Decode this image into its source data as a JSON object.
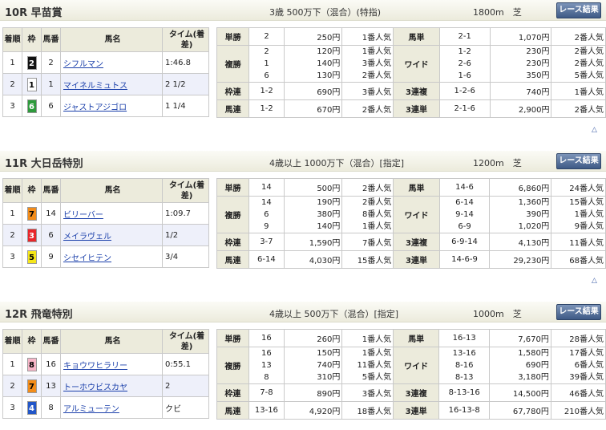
{
  "button_label": "レース結果",
  "top_link": "△",
  "headers": {
    "rank": "着順",
    "waku": "枠",
    "num": "馬番",
    "name": "馬名",
    "time": "タイム(着差)"
  },
  "pay_labels": {
    "tansho": "単勝",
    "fukusho": "複勝",
    "wakuren": "枠連",
    "umaren": "馬連",
    "umatan": "馬単",
    "wide": "ワイド",
    "sanrenpuku": "3連複",
    "sanrentan": "3連単"
  },
  "waku_colors": {
    "1": {
      "bg": "#ffffff",
      "fg": "#000000"
    },
    "2": {
      "bg": "#111111",
      "fg": "#ffffff"
    },
    "3": {
      "bg": "#e8262a",
      "fg": "#ffffff"
    },
    "4": {
      "bg": "#2256c8",
      "fg": "#ffffff"
    },
    "5": {
      "bg": "#f5e61a",
      "fg": "#000000"
    },
    "6": {
      "bg": "#2e9a3c",
      "fg": "#ffffff"
    },
    "7": {
      "bg": "#f28c1a",
      "fg": "#000000"
    },
    "8": {
      "bg": "#f7b6c8",
      "fg": "#000000"
    }
  },
  "races": [
    {
      "title": "10R 早苗賞",
      "conditions": "3歳 500万下（混合）(特指)",
      "distance": "1800m　芝",
      "results": [
        {
          "rank": "1",
          "waku": "2",
          "num": "2",
          "name": "シフルマン",
          "time": "1:46.8"
        },
        {
          "rank": "2",
          "waku": "1",
          "num": "1",
          "name": "マイネルミュトス",
          "time": "2 1/2"
        },
        {
          "rank": "3",
          "waku": "6",
          "num": "6",
          "name": "ジャストアジゴロ",
          "time": "1 1/4"
        }
      ],
      "tansho": {
        "combo": "2",
        "amount": "250円",
        "pop": "1番人気"
      },
      "fukusho": [
        {
          "combo": "2",
          "amount": "120円",
          "pop": "1番人気"
        },
        {
          "combo": "1",
          "amount": "140円",
          "pop": "3番人気"
        },
        {
          "combo": "6",
          "amount": "130円",
          "pop": "2番人気"
        }
      ],
      "wakuren": {
        "combo": "1-2",
        "amount": "690円",
        "pop": "3番人気"
      },
      "umaren": {
        "combo": "1-2",
        "amount": "670円",
        "pop": "2番人気"
      },
      "umatan": {
        "combo": "2-1",
        "amount": "1,070円",
        "pop": "2番人気"
      },
      "wide": [
        {
          "combo": "1-2",
          "amount": "230円",
          "pop": "2番人気"
        },
        {
          "combo": "2-6",
          "amount": "230円",
          "pop": "2番人気"
        },
        {
          "combo": "1-6",
          "amount": "350円",
          "pop": "5番人気"
        }
      ],
      "sanrenpuku": {
        "combo": "1-2-6",
        "amount": "740円",
        "pop": "1番人気"
      },
      "sanrentan": {
        "combo": "2-1-6",
        "amount": "2,900円",
        "pop": "2番人気"
      }
    },
    {
      "title": "11R 大日岳特別",
      "conditions": "4歳以上 1000万下（混合）[指定]",
      "distance": "1200m　芝",
      "results": [
        {
          "rank": "1",
          "waku": "7",
          "num": "14",
          "name": "ビリーバー",
          "time": "1:09.7"
        },
        {
          "rank": "2",
          "waku": "3",
          "num": "6",
          "name": "メイラヴェル",
          "time": "1/2"
        },
        {
          "rank": "3",
          "waku": "5",
          "num": "9",
          "name": "シセイヒテン",
          "time": "3/4"
        }
      ],
      "tansho": {
        "combo": "14",
        "amount": "500円",
        "pop": "2番人気"
      },
      "fukusho": [
        {
          "combo": "14",
          "amount": "190円",
          "pop": "2番人気"
        },
        {
          "combo": "6",
          "amount": "380円",
          "pop": "8番人気"
        },
        {
          "combo": "9",
          "amount": "140円",
          "pop": "1番人気"
        }
      ],
      "wakuren": {
        "combo": "3-7",
        "amount": "1,590円",
        "pop": "7番人気"
      },
      "umaren": {
        "combo": "6-14",
        "amount": "4,030円",
        "pop": "15番人気"
      },
      "umatan": {
        "combo": "14-6",
        "amount": "6,860円",
        "pop": "24番人気"
      },
      "wide": [
        {
          "combo": "6-14",
          "amount": "1,360円",
          "pop": "15番人気"
        },
        {
          "combo": "9-14",
          "amount": "390円",
          "pop": "1番人気"
        },
        {
          "combo": "6-9",
          "amount": "1,020円",
          "pop": "9番人気"
        }
      ],
      "sanrenpuku": {
        "combo": "6-9-14",
        "amount": "4,130円",
        "pop": "11番人気"
      },
      "sanrentan": {
        "combo": "14-6-9",
        "amount": "29,230円",
        "pop": "68番人気"
      }
    },
    {
      "title": "12R 飛竜特別",
      "conditions": "4歳以上 500万下（混合）[指定]",
      "distance": "1000m　芝",
      "results": [
        {
          "rank": "1",
          "waku": "8",
          "num": "16",
          "name": "キョウワヒラリー",
          "time": "0:55.1"
        },
        {
          "rank": "2",
          "waku": "7",
          "num": "13",
          "name": "トーホウビスカヤ",
          "time": "2"
        },
        {
          "rank": "3",
          "waku": "4",
          "num": "8",
          "name": "アルミューテン",
          "time": "クビ"
        }
      ],
      "tansho": {
        "combo": "16",
        "amount": "260円",
        "pop": "1番人気"
      },
      "fukusho": [
        {
          "combo": "16",
          "amount": "150円",
          "pop": "1番人気"
        },
        {
          "combo": "13",
          "amount": "740円",
          "pop": "11番人気"
        },
        {
          "combo": "8",
          "amount": "310円",
          "pop": "5番人気"
        }
      ],
      "wakuren": {
        "combo": "7-8",
        "amount": "890円",
        "pop": "3番人気"
      },
      "umaren": {
        "combo": "13-16",
        "amount": "4,920円",
        "pop": "18番人気"
      },
      "umatan": {
        "combo": "16-13",
        "amount": "7,670円",
        "pop": "28番人気"
      },
      "wide": [
        {
          "combo": "13-16",
          "amount": "1,580円",
          "pop": "17番人気"
        },
        {
          "combo": "8-16",
          "amount": "690円",
          "pop": "6番人気"
        },
        {
          "combo": "8-13",
          "amount": "3,180円",
          "pop": "39番人気"
        }
      ],
      "sanrenpuku": {
        "combo": "8-13-16",
        "amount": "14,500円",
        "pop": "46番人気"
      },
      "sanrentan": {
        "combo": "16-13-8",
        "amount": "67,780円",
        "pop": "210番人気"
      }
    }
  ]
}
